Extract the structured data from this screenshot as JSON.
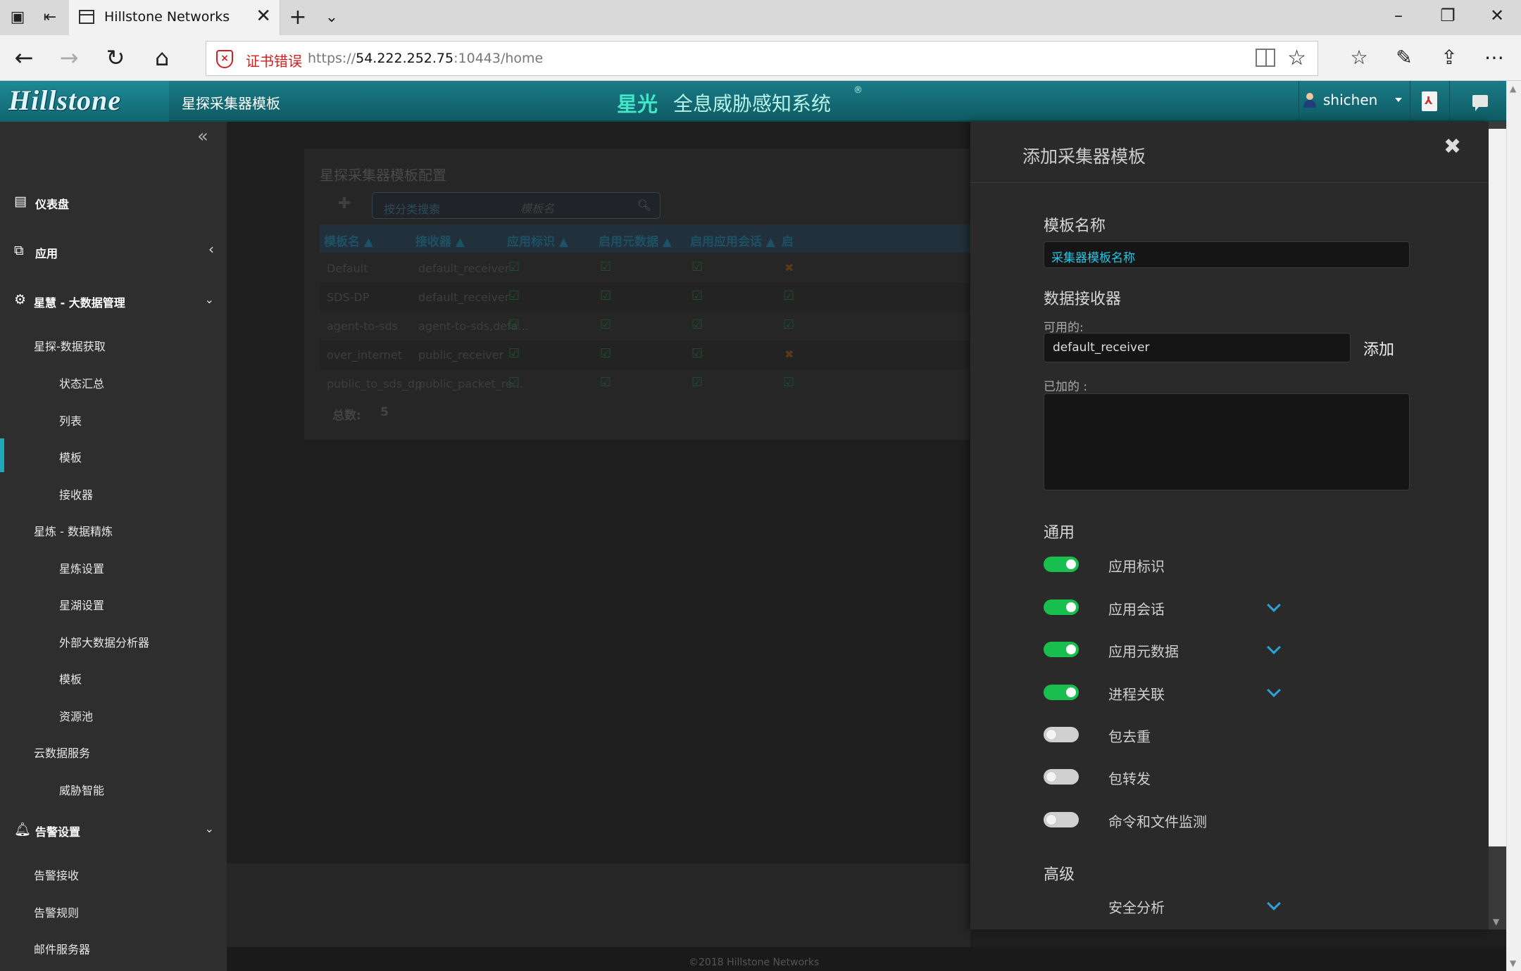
{
  "browser": {
    "tab_title": "Hillstone Networks",
    "cert_error": "证书错误",
    "url_scheme": "https://",
    "url_host": "54.222.252.75",
    "url_rest": ":10443/home"
  },
  "header": {
    "logo": "Hillstone",
    "page_title": "星探采集器模板",
    "brand": "星光",
    "brand_sub": "全息威胁感知系统",
    "brand_reg": "®",
    "user": "shichen"
  },
  "sidebar": {
    "items": [
      {
        "label": "仪表盘",
        "icon": "dashboard-icon"
      },
      {
        "label": "应用",
        "icon": "app-icon"
      },
      {
        "label": "星慧 - 大数据管理",
        "icon": "cogs-icon"
      },
      {
        "label": "星探-数据获取"
      },
      {
        "label": "状态汇总"
      },
      {
        "label": "列表"
      },
      {
        "label": "模板"
      },
      {
        "label": "接收器"
      },
      {
        "label": "星炼 - 数据精炼"
      },
      {
        "label": "星炼设置"
      },
      {
        "label": "星湖设置"
      },
      {
        "label": "外部大数据分析器"
      },
      {
        "label": "模板"
      },
      {
        "label": "资源池"
      },
      {
        "label": "云数据服务"
      },
      {
        "label": "威胁智能"
      },
      {
        "label": "告警设置",
        "icon": "bell-icon"
      },
      {
        "label": "告警接收"
      },
      {
        "label": "告警规则"
      },
      {
        "label": "邮件服务器"
      }
    ]
  },
  "config": {
    "title": "星探采集器模板配置",
    "search_placeholder": "按分类搜索",
    "search_field": "模板名",
    "headers": [
      "模板名 ▲",
      "接收器 ▲",
      "应用标识 ▲",
      "启用元数据 ▲",
      "启用应用会话 ▲",
      "启"
    ],
    "rows": [
      {
        "name": "Default",
        "receiver": "default_receiver",
        "last": "x"
      },
      {
        "name": "SDS-DP",
        "receiver": "default_receiver",
        "last": "check"
      },
      {
        "name": "agent-to-sds",
        "receiver": "agent-to-sds,defa...",
        "last": "check"
      },
      {
        "name": "over_internet",
        "receiver": "public_receiver",
        "last": "x"
      },
      {
        "name": "public_to_sds_dp",
        "receiver": "public_packet_re...",
        "last": "check"
      }
    ],
    "total_label": "总数:",
    "total_value": "5"
  },
  "footer": "©2018 Hillstone Networks",
  "drawer": {
    "title": "添加采集器模板",
    "name_section": "模板名称",
    "name_placeholder": "采集器模板名称",
    "receiver_section": "数据接收器",
    "available_label": "可用的:",
    "available_value": "default_receiver",
    "add_button": "添加",
    "added_label": "已加的 :",
    "general_section": "通用",
    "toggles": [
      {
        "label": "应用标识",
        "on": true,
        "expand": false
      },
      {
        "label": "应用会话",
        "on": true,
        "expand": true
      },
      {
        "label": "应用元数据",
        "on": true,
        "expand": true
      },
      {
        "label": "进程关联",
        "on": true,
        "expand": true
      },
      {
        "label": "包去重",
        "on": false,
        "expand": false
      },
      {
        "label": "包转发",
        "on": false,
        "expand": false
      },
      {
        "label": "命令和文件监测",
        "on": false,
        "expand": false
      }
    ],
    "advanced_section": "高级",
    "security_analysis": "安全分析"
  },
  "colors": {
    "header_teal": "#197b87",
    "accent_cyan": "#1fa9bb",
    "toggle_on": "#19bf4e",
    "chevron_blue": "#2aa3d6",
    "cert_error_red": "#d21f1f"
  }
}
